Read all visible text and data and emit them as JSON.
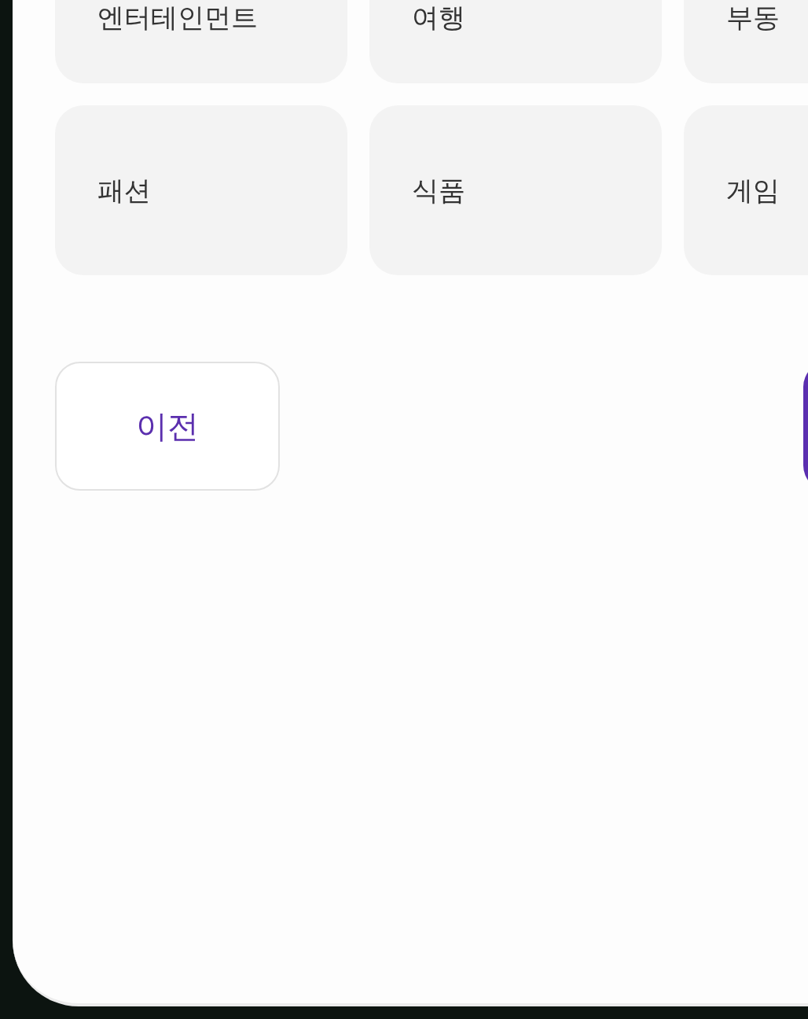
{
  "categories": [
    {
      "label": "엔터테인먼트"
    },
    {
      "label": "여행"
    },
    {
      "label": "부동"
    },
    {
      "label": "패션"
    },
    {
      "label": "식품"
    },
    {
      "label": "게임"
    }
  ],
  "buttons": [
    {
      "kind": "secondary",
      "label": "이전"
    },
    {
      "kind": "primary"
    }
  ]
}
